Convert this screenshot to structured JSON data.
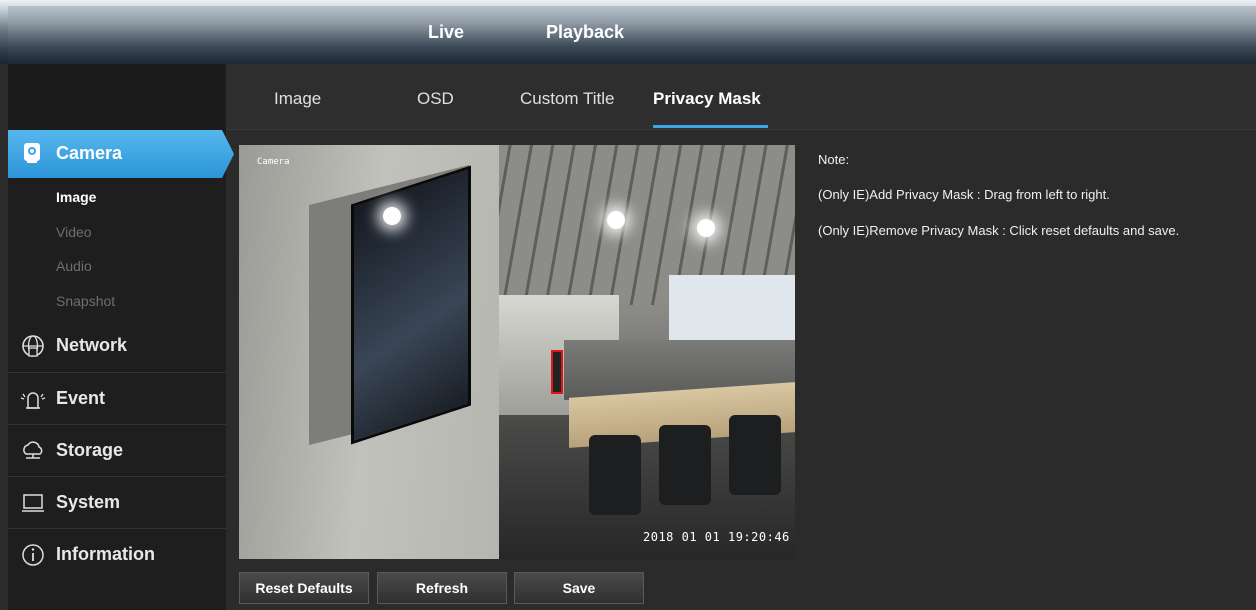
{
  "top_nav": {
    "live": "Live",
    "playback": "Playback"
  },
  "sidebar": {
    "active": {
      "label": "Camera",
      "icon": "camera-icon"
    },
    "sub_items": [
      "Image",
      "Video",
      "Audio",
      "Snapshot"
    ],
    "active_sub": "Image",
    "items": [
      {
        "label": "Network",
        "icon": "network-globe-icon"
      },
      {
        "label": "Event",
        "icon": "alarm-icon"
      },
      {
        "label": "Storage",
        "icon": "cloud-storage-icon"
      },
      {
        "label": "System",
        "icon": "monitor-icon"
      },
      {
        "label": "Information",
        "icon": "info-icon"
      }
    ]
  },
  "tabs": [
    "Image",
    "OSD",
    "Custom Title",
    "Privacy Mask"
  ],
  "active_tab": "Privacy Mask",
  "video": {
    "overlay_title": "Camera",
    "timestamp": "2018 01 01  19:20:46"
  },
  "notes": [
    "Note:",
    "(Only IE)Add Privacy Mask : Drag from left to right.",
    "(Only IE)Remove Privacy Mask : Click reset defaults and save."
  ],
  "buttons": {
    "reset": "Reset Defaults",
    "refresh": "Refresh",
    "save": "Save"
  },
  "colors": {
    "accent": "#3ba7ea",
    "mask_border": "#e01616"
  }
}
